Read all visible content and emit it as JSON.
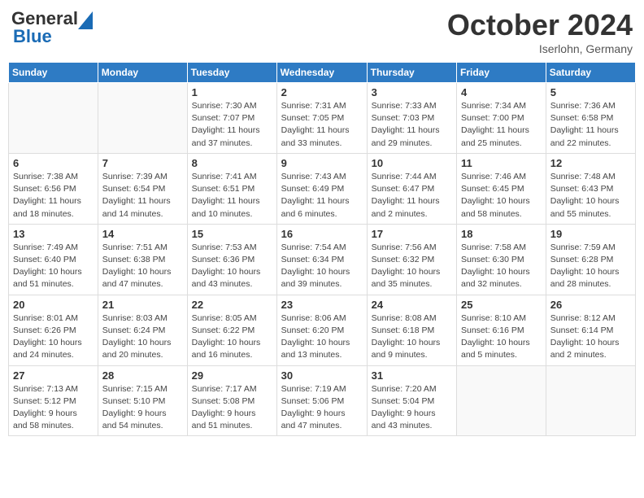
{
  "header": {
    "logo": "GeneralBlue",
    "month": "October 2024",
    "location": "Iserlohn, Germany"
  },
  "weekdays": [
    "Sunday",
    "Monday",
    "Tuesday",
    "Wednesday",
    "Thursday",
    "Friday",
    "Saturday"
  ],
  "weeks": [
    [
      {
        "day": "",
        "info": ""
      },
      {
        "day": "",
        "info": ""
      },
      {
        "day": "1",
        "info": "Sunrise: 7:30 AM\nSunset: 7:07 PM\nDaylight: 11 hours\nand 37 minutes."
      },
      {
        "day": "2",
        "info": "Sunrise: 7:31 AM\nSunset: 7:05 PM\nDaylight: 11 hours\nand 33 minutes."
      },
      {
        "day": "3",
        "info": "Sunrise: 7:33 AM\nSunset: 7:03 PM\nDaylight: 11 hours\nand 29 minutes."
      },
      {
        "day": "4",
        "info": "Sunrise: 7:34 AM\nSunset: 7:00 PM\nDaylight: 11 hours\nand 25 minutes."
      },
      {
        "day": "5",
        "info": "Sunrise: 7:36 AM\nSunset: 6:58 PM\nDaylight: 11 hours\nand 22 minutes."
      }
    ],
    [
      {
        "day": "6",
        "info": "Sunrise: 7:38 AM\nSunset: 6:56 PM\nDaylight: 11 hours\nand 18 minutes."
      },
      {
        "day": "7",
        "info": "Sunrise: 7:39 AM\nSunset: 6:54 PM\nDaylight: 11 hours\nand 14 minutes."
      },
      {
        "day": "8",
        "info": "Sunrise: 7:41 AM\nSunset: 6:51 PM\nDaylight: 11 hours\nand 10 minutes."
      },
      {
        "day": "9",
        "info": "Sunrise: 7:43 AM\nSunset: 6:49 PM\nDaylight: 11 hours\nand 6 minutes."
      },
      {
        "day": "10",
        "info": "Sunrise: 7:44 AM\nSunset: 6:47 PM\nDaylight: 11 hours\nand 2 minutes."
      },
      {
        "day": "11",
        "info": "Sunrise: 7:46 AM\nSunset: 6:45 PM\nDaylight: 10 hours\nand 58 minutes."
      },
      {
        "day": "12",
        "info": "Sunrise: 7:48 AM\nSunset: 6:43 PM\nDaylight: 10 hours\nand 55 minutes."
      }
    ],
    [
      {
        "day": "13",
        "info": "Sunrise: 7:49 AM\nSunset: 6:40 PM\nDaylight: 10 hours\nand 51 minutes."
      },
      {
        "day": "14",
        "info": "Sunrise: 7:51 AM\nSunset: 6:38 PM\nDaylight: 10 hours\nand 47 minutes."
      },
      {
        "day": "15",
        "info": "Sunrise: 7:53 AM\nSunset: 6:36 PM\nDaylight: 10 hours\nand 43 minutes."
      },
      {
        "day": "16",
        "info": "Sunrise: 7:54 AM\nSunset: 6:34 PM\nDaylight: 10 hours\nand 39 minutes."
      },
      {
        "day": "17",
        "info": "Sunrise: 7:56 AM\nSunset: 6:32 PM\nDaylight: 10 hours\nand 35 minutes."
      },
      {
        "day": "18",
        "info": "Sunrise: 7:58 AM\nSunset: 6:30 PM\nDaylight: 10 hours\nand 32 minutes."
      },
      {
        "day": "19",
        "info": "Sunrise: 7:59 AM\nSunset: 6:28 PM\nDaylight: 10 hours\nand 28 minutes."
      }
    ],
    [
      {
        "day": "20",
        "info": "Sunrise: 8:01 AM\nSunset: 6:26 PM\nDaylight: 10 hours\nand 24 minutes."
      },
      {
        "day": "21",
        "info": "Sunrise: 8:03 AM\nSunset: 6:24 PM\nDaylight: 10 hours\nand 20 minutes."
      },
      {
        "day": "22",
        "info": "Sunrise: 8:05 AM\nSunset: 6:22 PM\nDaylight: 10 hours\nand 16 minutes."
      },
      {
        "day": "23",
        "info": "Sunrise: 8:06 AM\nSunset: 6:20 PM\nDaylight: 10 hours\nand 13 minutes."
      },
      {
        "day": "24",
        "info": "Sunrise: 8:08 AM\nSunset: 6:18 PM\nDaylight: 10 hours\nand 9 minutes."
      },
      {
        "day": "25",
        "info": "Sunrise: 8:10 AM\nSunset: 6:16 PM\nDaylight: 10 hours\nand 5 minutes."
      },
      {
        "day": "26",
        "info": "Sunrise: 8:12 AM\nSunset: 6:14 PM\nDaylight: 10 hours\nand 2 minutes."
      }
    ],
    [
      {
        "day": "27",
        "info": "Sunrise: 7:13 AM\nSunset: 5:12 PM\nDaylight: 9 hours\nand 58 minutes."
      },
      {
        "day": "28",
        "info": "Sunrise: 7:15 AM\nSunset: 5:10 PM\nDaylight: 9 hours\nand 54 minutes."
      },
      {
        "day": "29",
        "info": "Sunrise: 7:17 AM\nSunset: 5:08 PM\nDaylight: 9 hours\nand 51 minutes."
      },
      {
        "day": "30",
        "info": "Sunrise: 7:19 AM\nSunset: 5:06 PM\nDaylight: 9 hours\nand 47 minutes."
      },
      {
        "day": "31",
        "info": "Sunrise: 7:20 AM\nSunset: 5:04 PM\nDaylight: 9 hours\nand 43 minutes."
      },
      {
        "day": "",
        "info": ""
      },
      {
        "day": "",
        "info": ""
      }
    ]
  ]
}
